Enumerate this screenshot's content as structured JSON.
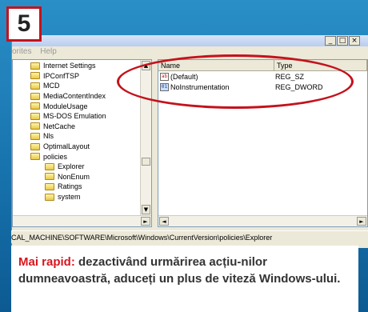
{
  "step_number": "5",
  "window": {
    "controls": [
      "_",
      "□",
      "×"
    ],
    "menu": [
      "orites",
      "Help"
    ]
  },
  "tree": {
    "items": [
      {
        "label": "Internet Settings",
        "level": 0
      },
      {
        "label": "IPConfTSP",
        "level": 0
      },
      {
        "label": "MCD",
        "level": 0
      },
      {
        "label": "MediaContentIndex",
        "level": 0
      },
      {
        "label": "ModuleUsage",
        "level": 0
      },
      {
        "label": "MS-DOS Emulation",
        "level": 0
      },
      {
        "label": "NetCache",
        "level": 0
      },
      {
        "label": "Nls",
        "level": 0
      },
      {
        "label": "OptimalLayout",
        "level": 0
      },
      {
        "label": "policies",
        "level": 0
      },
      {
        "label": "Explorer",
        "level": 1
      },
      {
        "label": "NonEnum",
        "level": 1
      },
      {
        "label": "Ratings",
        "level": 1
      },
      {
        "label": "system",
        "level": 1
      }
    ]
  },
  "list": {
    "columns": [
      "Name",
      "Type"
    ],
    "rows": [
      {
        "name": "(Default)",
        "type": "REG_SZ",
        "icon": "string-value-icon"
      },
      {
        "name": "NoInstrumentation",
        "type": "REG_DWORD",
        "icon": "dword-value-icon"
      }
    ]
  },
  "status_bar": "CAL_MACHINE\\SOFTWARE\\Microsoft\\Windows\\CurrentVersion\\policies\\Explorer",
  "caption": {
    "highlight": "Mai rapid:",
    "text": " dezactivând urmărirea acțiu-nilor dumneavoastră, aduceți un plus de viteză Windows-ului."
  },
  "colors": {
    "accent": "#c4121c",
    "background": "#1f7fb6"
  }
}
